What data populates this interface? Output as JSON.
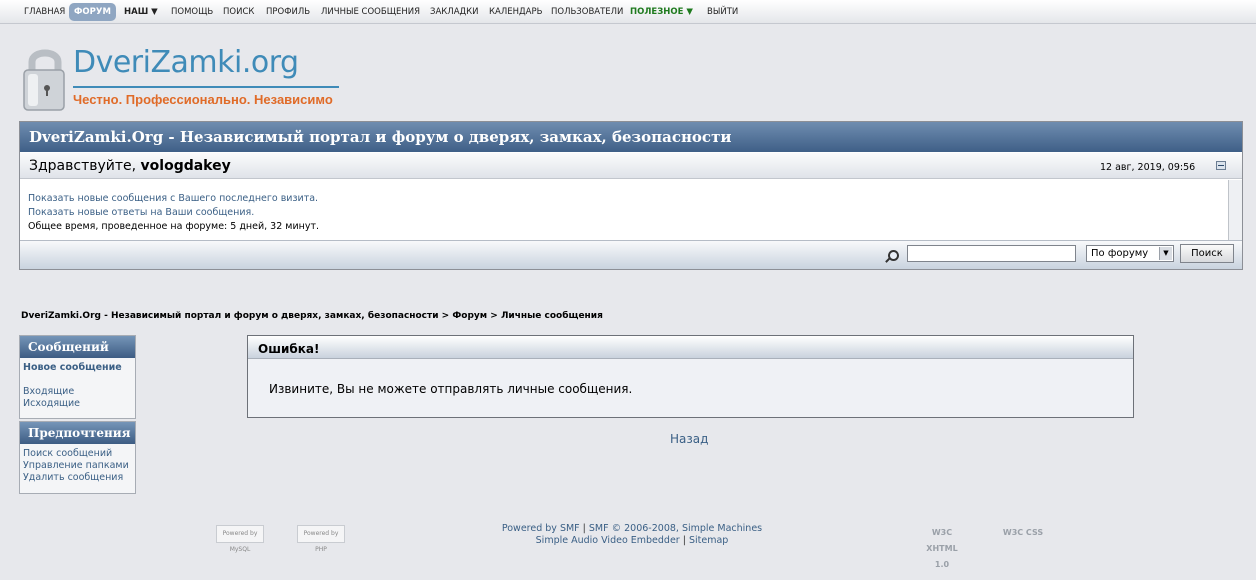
{
  "nav": {
    "items": [
      "Главная",
      "Форум",
      "Наш ▼",
      "Помощь",
      "Поиск",
      "Профиль",
      "Личные сообщения",
      "Закладки",
      "Календарь",
      "Пользователи",
      "Полезное ▼",
      "Выйти"
    ]
  },
  "logo": {
    "title": "DveriZamki.org",
    "slogan": "Честно. Профессионально. Независимо"
  },
  "header": {
    "title": "DveriZamki.Org - Независимый портал и форум о дверях, замках, безопасности",
    "greeting": "Здравствуйте, ",
    "username": "vologdakey",
    "datetime": "12 авг, 2019, 09:56"
  },
  "info": {
    "new_posts": "Показать новые сообщения с Вашего последнего визита.",
    "new_replies": "Показать новые ответы на Ваши сообщения.",
    "online_time": "Общее время, проведенное на форуме: 5 дней, 32 минут."
  },
  "search": {
    "select_value": "По форуму",
    "button": "Поиск"
  },
  "breadcrumb": {
    "site": "DveriZamki.Org - Независимый портал и форум о дверях, замках, безопасности",
    "sep": " > ",
    "forum": "Форум",
    "current": "Личные сообщения"
  },
  "sidebar": {
    "messages_header": "Сообщений",
    "new_message": "Новое сообщение",
    "inbox": "Входящие",
    "outbox": "Исходящие",
    "prefs_header": "Предпочтения",
    "search_messages": "Поиск сообщений",
    "manage_folders": "Управление папками",
    "delete_messages": "Удалить сообщения"
  },
  "error": {
    "title": "Ошибка!",
    "message": "Извините, Вы не можете отправлять личные сообщения."
  },
  "back_label": "Назад",
  "footer": {
    "powered": "Powered by SMF",
    "sep": " | ",
    "copyright": "SMF © 2006-2008, Simple Machines",
    "embedder": "Simple Audio Video Embedder",
    "sitemap": "Sitemap",
    "badge_mysql": "Powered by MySQL",
    "badge_php": "Powered by PHP",
    "badge_xhtml": "W3C XHTML 1.0",
    "badge_css": "W3C CSS"
  }
}
